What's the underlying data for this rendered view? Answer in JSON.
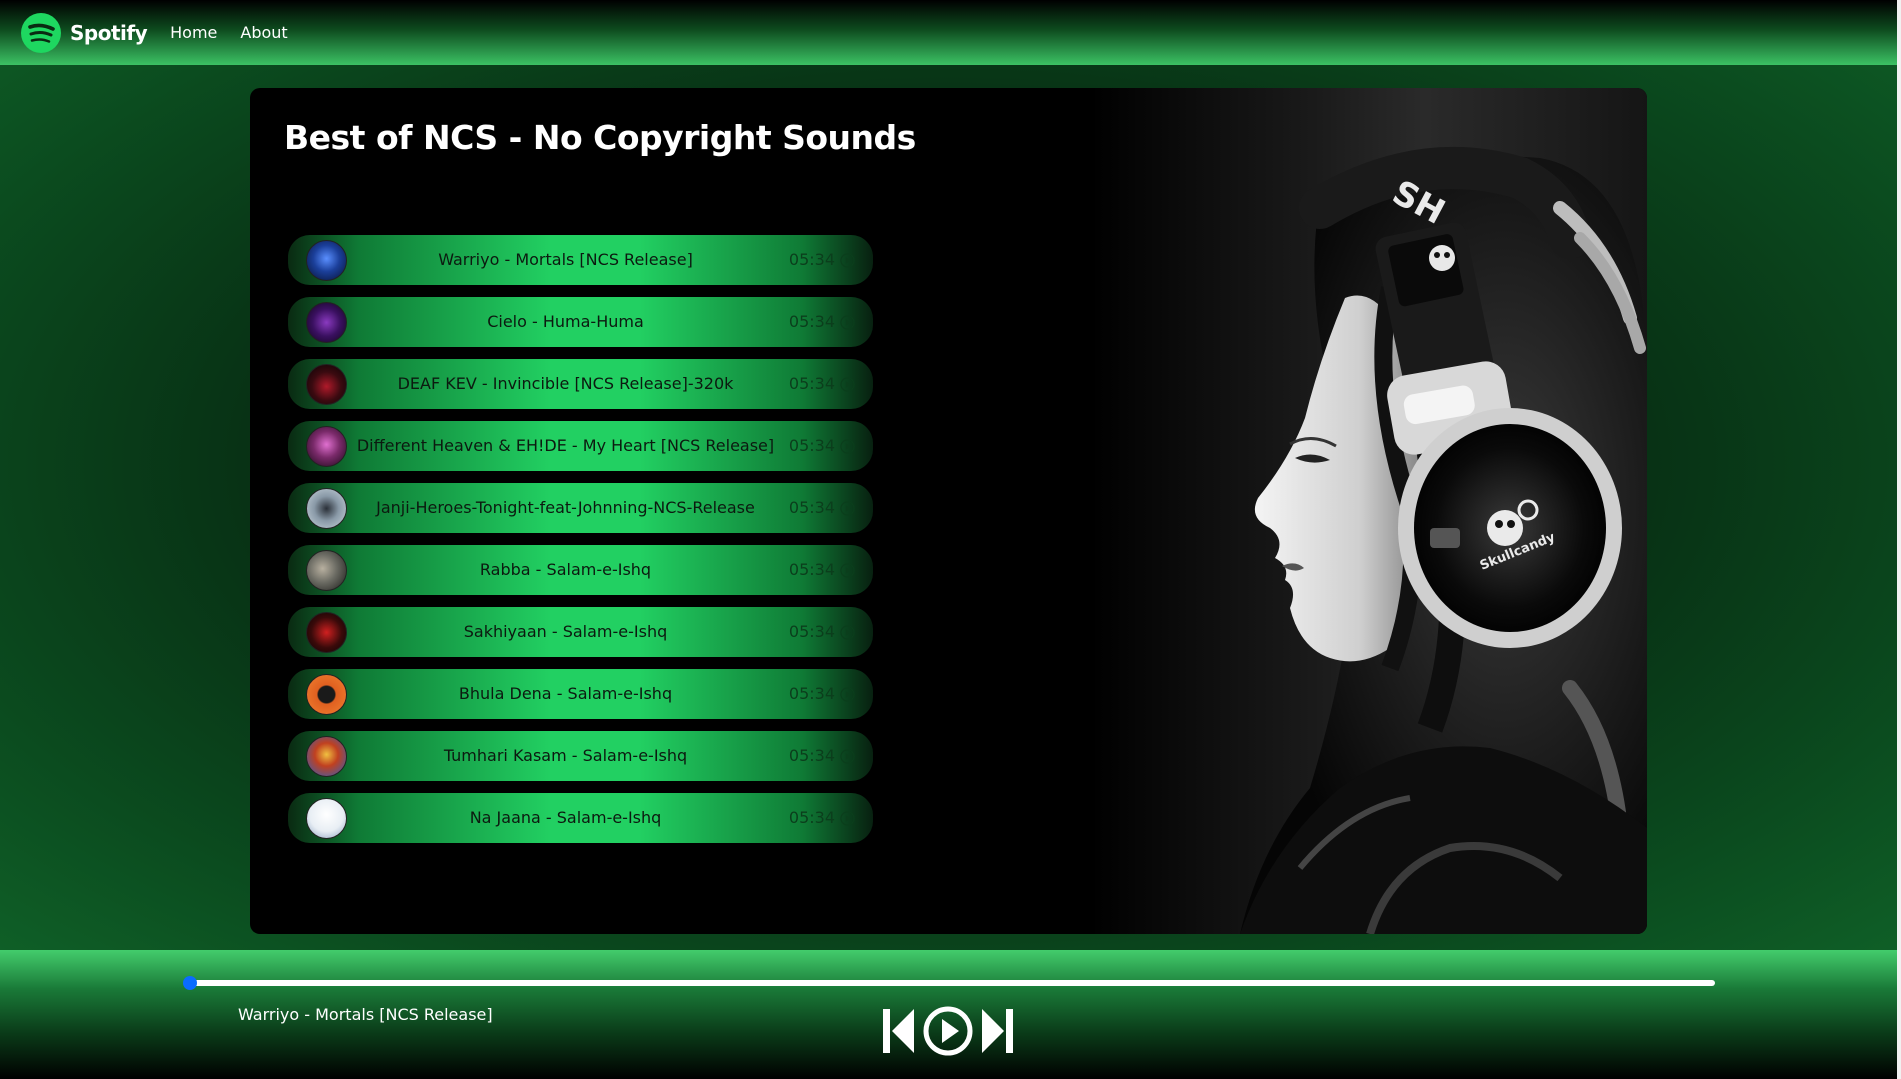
{
  "navbar": {
    "brand": "Spotify",
    "links": [
      "Home",
      "About"
    ]
  },
  "playlist": {
    "title": "Best of NCS - No Copyright Sounds",
    "songs": [
      {
        "name": "Warriyo - Mortals [NCS Release]",
        "duration": "05:34",
        "cover": "#1b3f9a"
      },
      {
        "name": "Cielo - Huma-Huma",
        "duration": "05:34",
        "cover": "#4a1a6a"
      },
      {
        "name": "DEAF KEV - Invincible [NCS Release]-320k",
        "duration": "05:34",
        "cover": "#2a0a10"
      },
      {
        "name": "Different Heaven & EH!DE - My Heart [NCS Release]",
        "duration": "05:34",
        "cover": "#7a2a6a"
      },
      {
        "name": "Janji-Heroes-Tonight-feat-Johnning-NCS-Release",
        "duration": "05:34",
        "cover": "#8a9aa8"
      },
      {
        "name": "Rabba - Salam-e-Ishq",
        "duration": "05:34",
        "cover": "#6a6a62"
      },
      {
        "name": "Sakhiyaan - Salam-e-Ishq",
        "duration": "05:34",
        "cover": "#3a0a0a"
      },
      {
        "name": "Bhula Dena - Salam-e-Ishq",
        "duration": "05:34",
        "cover": "#e06020"
      },
      {
        "name": "Tumhari Kasam - Salam-e-Ishq",
        "duration": "05:34",
        "cover": "#c04020"
      },
      {
        "name": "Na Jaana - Salam-e-Ishq",
        "duration": "05:34",
        "cover": "#e8eef4"
      }
    ]
  },
  "player": {
    "now_playing": "Warriyo - Mortals [NCS Release]",
    "progress": 0,
    "icons": [
      "previous-icon",
      "play-icon",
      "next-icon"
    ]
  },
  "colors": {
    "accent": "#22d062",
    "thumb": "#0a6cff"
  }
}
